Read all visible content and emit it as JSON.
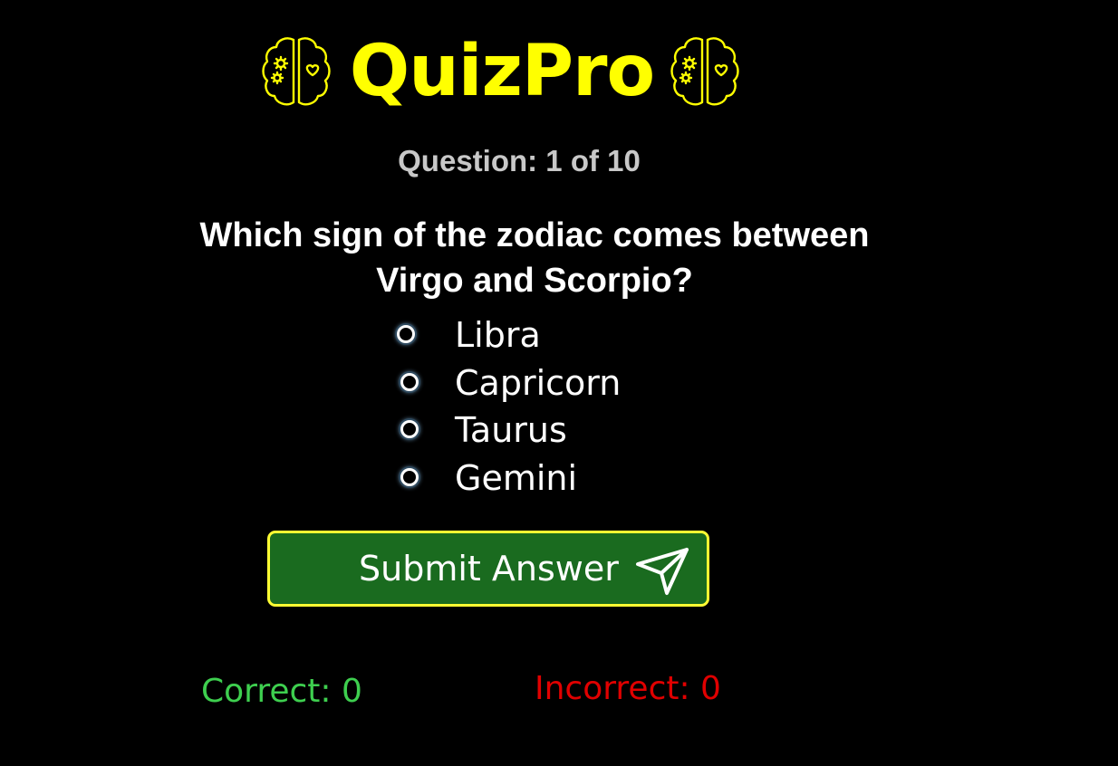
{
  "header": {
    "title": "QuizPro",
    "left_icon": "brain-icon",
    "right_icon": "brain-icon"
  },
  "progress": {
    "text": "Question: 1 of 10",
    "current": 1,
    "total": 10
  },
  "question": {
    "text": "Which sign of the zodiac comes between Virgo and Scorpio?"
  },
  "options": [
    {
      "label": "Libra",
      "selected": false
    },
    {
      "label": "Capricorn",
      "selected": false
    },
    {
      "label": "Taurus",
      "selected": false
    },
    {
      "label": "Gemini",
      "selected": false
    }
  ],
  "submit": {
    "label": "Submit Answer",
    "icon": "send-icon"
  },
  "score": {
    "correct_text": "Correct: 0",
    "incorrect_text": "Incorrect: 0"
  },
  "colors": {
    "background": "#000000",
    "title": "#ffff00",
    "progress": "#c8c8c8",
    "submit_bg": "#1a6b1f",
    "submit_border": "#ffff33",
    "correct": "#3ecf4f",
    "incorrect": "#e00000"
  }
}
